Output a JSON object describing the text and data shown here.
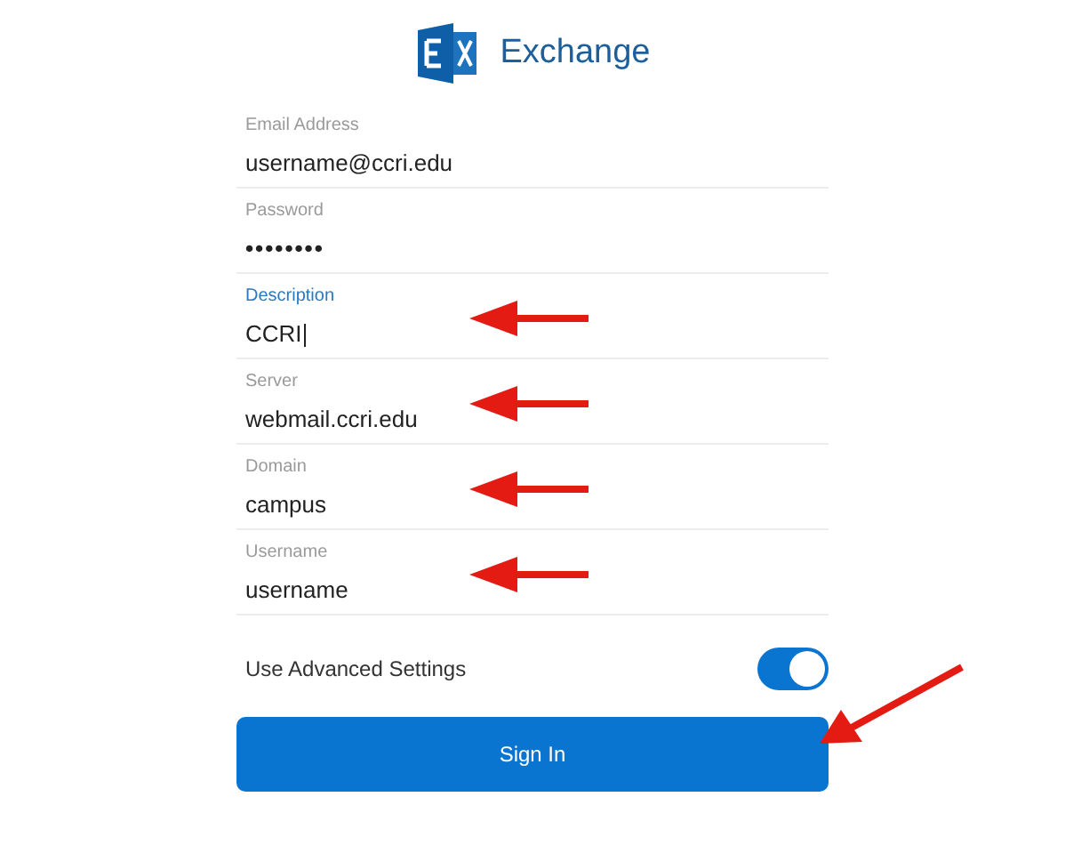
{
  "header": {
    "title": "Exchange"
  },
  "fields": [
    {
      "label": "Email Address",
      "value": "username@ccri.edu",
      "focused": false,
      "arrow": false
    },
    {
      "label": "Password",
      "value": "••••••••",
      "focused": false,
      "arrow": false
    },
    {
      "label": "Description",
      "value": "CCRI",
      "focused": true,
      "arrow": true
    },
    {
      "label": "Server",
      "value": "webmail.ccri.edu",
      "focused": false,
      "arrow": true
    },
    {
      "label": "Domain",
      "value": "campus",
      "focused": false,
      "arrow": true
    },
    {
      "label": "Username",
      "value": "username",
      "focused": false,
      "arrow": true
    }
  ],
  "advanced": {
    "label": "Use Advanced Settings",
    "on": true
  },
  "sign_in": {
    "label": "Sign In",
    "arrow": true
  }
}
